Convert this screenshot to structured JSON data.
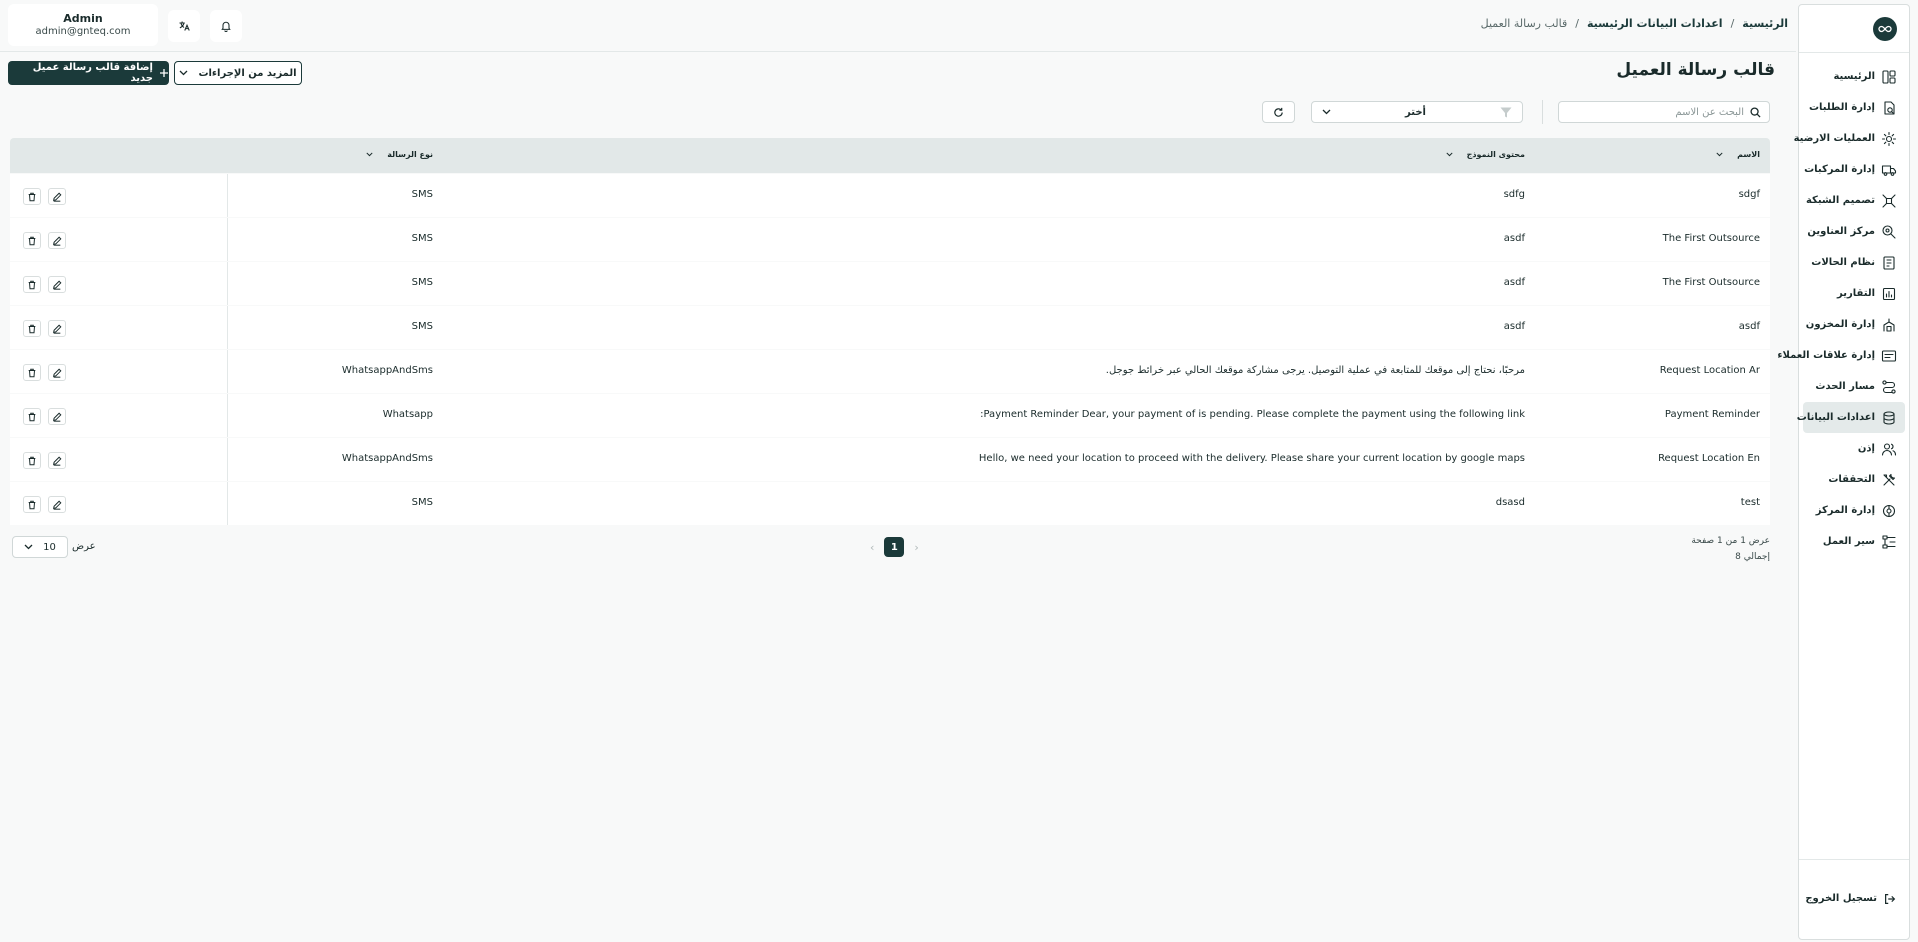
{
  "header": {
    "user_name": "Admin",
    "user_email": "admin@gnteq.com",
    "breadcrumb": [
      "الرئيسية",
      "اعدادات البيانات الرئيسية",
      "قالب رسالة العميل"
    ],
    "separator": "/"
  },
  "sidebar": {
    "items": [
      {
        "label": "الرئيسية",
        "icon": "dashboard-icon"
      },
      {
        "label": "إدارة الطلبات",
        "icon": "orders-icon"
      },
      {
        "label": "العمليات الارضية",
        "icon": "ground-ops-icon"
      },
      {
        "label": "إدارة المركبات",
        "icon": "truck-icon"
      },
      {
        "label": "تصميم الشبكة",
        "icon": "network-icon"
      },
      {
        "label": "مركز العناوين",
        "icon": "address-icon"
      },
      {
        "label": "نظام الحالات",
        "icon": "status-icon"
      },
      {
        "label": "التقارير",
        "icon": "reports-icon"
      },
      {
        "label": "إدارة المخزون",
        "icon": "inventory-icon"
      },
      {
        "label": "إدارة علاقات العملاء",
        "icon": "crm-icon"
      },
      {
        "label": "مسار الحدث",
        "icon": "route-icon"
      },
      {
        "label": "اعدادات البيانات",
        "icon": "database-icon",
        "active": true
      },
      {
        "label": "إذن",
        "icon": "users-icon"
      },
      {
        "label": "التحققات",
        "icon": "tools-icon"
      },
      {
        "label": "إدارة المركز",
        "icon": "hub-icon"
      },
      {
        "label": "سير العمل",
        "icon": "workflow-icon"
      }
    ],
    "logout_label": "تسجيل الخروج"
  },
  "page": {
    "title": "قالب رسالة العميل",
    "add_button": "إضافة قالب رسالة عميل جديد",
    "more_actions": "المزيد من الإجراءات"
  },
  "filters": {
    "search_placeholder": "البحث عن الاسم",
    "select_value": "أختر"
  },
  "table": {
    "columns": [
      "الاسم",
      "محتوى النموذج",
      "نوع الرسالة"
    ],
    "rows": [
      {
        "name": "sdgf",
        "content": "sdfg",
        "type": "SMS"
      },
      {
        "name": "The First Outsource",
        "content": "asdf",
        "type": "SMS"
      },
      {
        "name": "The First Outsource",
        "content": "asdf",
        "type": "SMS"
      },
      {
        "name": "asdf",
        "content": "asdf",
        "type": "SMS"
      },
      {
        "name": "Request Location Ar",
        "content": ".مرحبًا، نحتاج إلى موقعك للمتابعة في عملية التوصيل. يرجى مشاركة موقعك الحالي عبر خرائط جوجل",
        "type": "WhatsappAndSms"
      },
      {
        "name": "Payment Reminder",
        "content": ":Payment Reminder Dear, your payment of is pending. Please complete the payment using the following link",
        "type": "Whatsapp"
      },
      {
        "name": "Request Location En",
        "content": "Hello, we need your location to proceed with the delivery. Please share your current location by google maps",
        "type": "WhatsappAndSms"
      },
      {
        "name": "test",
        "content": "dsasd",
        "type": "SMS"
      }
    ]
  },
  "footer": {
    "page_info": "عرض 1 من 1 صفحة",
    "total": "إجمالي 8",
    "current_page": "1",
    "show_label": "عرض",
    "page_size": "10"
  }
}
